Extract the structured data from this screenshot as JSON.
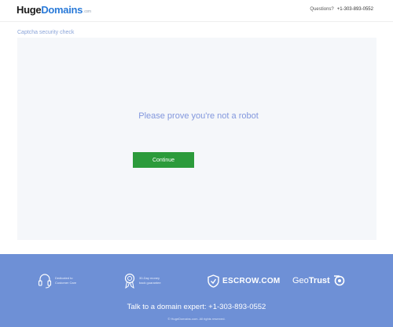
{
  "header": {
    "logo_huge": "Huge",
    "logo_domains": "Domains",
    "logo_dotcom": ".com",
    "questions_label": "Questions?",
    "phone": "+1-303-893-0552"
  },
  "captcha": {
    "label": "Captcha security check",
    "prompt": "Please prove you're not a robot",
    "continue_label": "Continue"
  },
  "footer": {
    "badges": [
      {
        "icon": "headset-icon",
        "line1": "Dedicated to",
        "line2": "Customer Care"
      },
      {
        "icon": "ribbon-icon",
        "line1": "30-Day money",
        "line2": "back guarantee"
      },
      {
        "icon": "shield-icon",
        "text": "ESCROW.COM"
      },
      {
        "icon": "geotrust-icon",
        "text_pre": "Geo",
        "text_bold": "Trust"
      }
    ],
    "expert_text": "Talk to a domain expert: +1-303-893-0552",
    "copyright": "© HugeDomains.com. All rights reserved."
  },
  "colors": {
    "brand_blue": "#2a7ad8",
    "footer_bg": "#6e90d6",
    "continue_green": "#2c9b3b",
    "prompt_text": "#8297dd"
  }
}
